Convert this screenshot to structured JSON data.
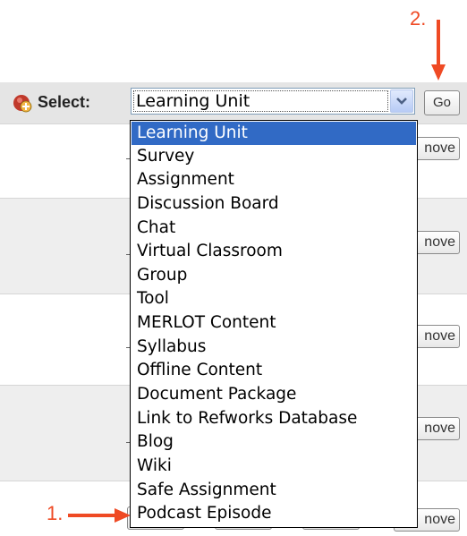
{
  "annotations": {
    "step_1": "1.",
    "step_2": "2."
  },
  "toolbar": {
    "icon": "add-item-icon",
    "select_label": "Select:",
    "select_value": "Learning Unit",
    "go_label": "Go"
  },
  "dropdown": {
    "options": [
      "Learning Unit",
      "Survey",
      "Assignment",
      "Discussion Board",
      "Chat",
      "Virtual Classroom",
      "Group",
      "Tool",
      "MERLOT Content",
      "Syllabus",
      "Offline Content",
      "Document Package",
      "Link to Refworks Database",
      "Blog",
      "Wiki",
      "Safe Assignment",
      "Podcast Episode"
    ],
    "selected_index": 0
  },
  "rows": {
    "remove_label_partial": "nove"
  },
  "colors": {
    "annotation": "#ef4a24",
    "selection": "#316ac5",
    "toolbar_bg": "#e5e5e5"
  }
}
